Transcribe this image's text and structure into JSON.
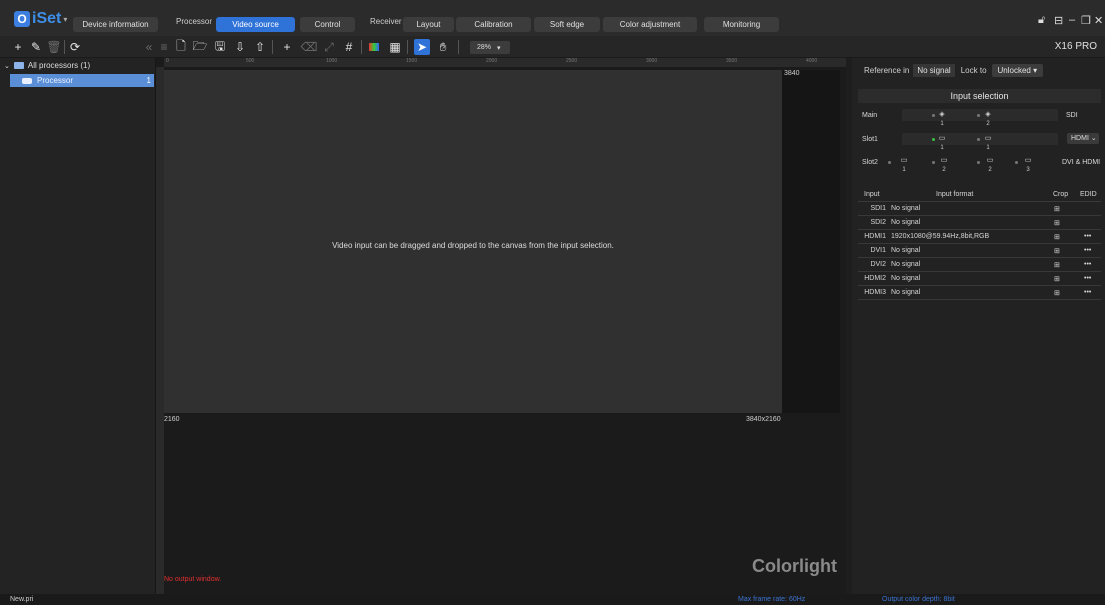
{
  "app": {
    "name": "iSet",
    "model": "X16 PRO"
  },
  "groups": {
    "processor": "Processor",
    "receiver": "Receiver"
  },
  "tabs": [
    "Device information",
    "Video source",
    "Control",
    "Layout",
    "Calibration",
    "Soft edge",
    "Color adjustment",
    "Monitoring"
  ],
  "active_tab": "Video source",
  "toolbar": {
    "zoom": "28%"
  },
  "tree": {
    "root": "All processors (1)",
    "item": "Processor",
    "item_count": "1"
  },
  "canvas": {
    "ruler_ticks": [
      "0",
      "500",
      "1000",
      "1500",
      "2000",
      "2500",
      "3000",
      "3500",
      "4000"
    ],
    "width_label": "3840",
    "height_label": "2160",
    "size_label": "3840x2160",
    "hint": "Video input can be dragged and dropped to the canvas from the input selection.",
    "no_output": "No output window.",
    "brand": "Colorlight"
  },
  "right": {
    "reference_label": "Reference in",
    "reference_value": "No signal",
    "lock_label": "Lock to",
    "lock_value": "Unlocked",
    "input_selection_title": "Input selection",
    "main_label": "Main",
    "slot1_label": "Slot1",
    "slot2_label": "Slot2",
    "main_type": "SDI",
    "slot1_type": "HDMI",
    "slot2_type": "DVI & HDMI",
    "main_ports": [
      "1",
      "2"
    ],
    "slot1_ports": [
      "1",
      "1"
    ],
    "slot2_ports": [
      "1",
      "2",
      "2",
      "3"
    ],
    "table_headers": {
      "input": "Input",
      "format": "Input format",
      "crop": "Crop",
      "edid": "EDID"
    },
    "rows": [
      {
        "input": "SDI1",
        "format": "No signal",
        "edid": ""
      },
      {
        "input": "SDI2",
        "format": "No signal",
        "edid": ""
      },
      {
        "input": "HDMI1",
        "format": "1920x1080@59.94Hz,8bit,RGB",
        "edid": "•••"
      },
      {
        "input": "DVI1",
        "format": "No signal",
        "edid": "•••"
      },
      {
        "input": "DVI2",
        "format": "No signal",
        "edid": "•••"
      },
      {
        "input": "HDMI2",
        "format": "No signal",
        "edid": "•••"
      },
      {
        "input": "HDMI3",
        "format": "No signal",
        "edid": "•••"
      }
    ]
  },
  "status": {
    "file": "New.pri",
    "frame_rate": "Max frame rate: 60Hz",
    "color_depth": "Output color depth: 8bit"
  },
  "colors": {
    "accent": "#2f72d8",
    "tree_selected": "#5a8fd8",
    "warning": "#e03030",
    "status_active": "#3ac040"
  }
}
